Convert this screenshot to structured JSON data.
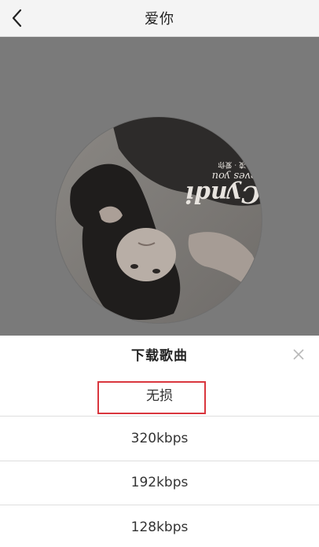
{
  "header": {
    "title": "爱你",
    "back_icon": "chevron-left-icon"
  },
  "album": {
    "cover_text_main": "Cyndi",
    "cover_text_sub": "loves you",
    "cover_text_artist": "王心凌 · 爱你"
  },
  "download_sheet": {
    "title": "下载歌曲",
    "close_icon": "close-icon",
    "options": [
      {
        "label": "无损"
      },
      {
        "label": "320kbps"
      },
      {
        "label": "192kbps"
      },
      {
        "label": "128kbps"
      }
    ],
    "highlight_color": "#d9363e"
  }
}
